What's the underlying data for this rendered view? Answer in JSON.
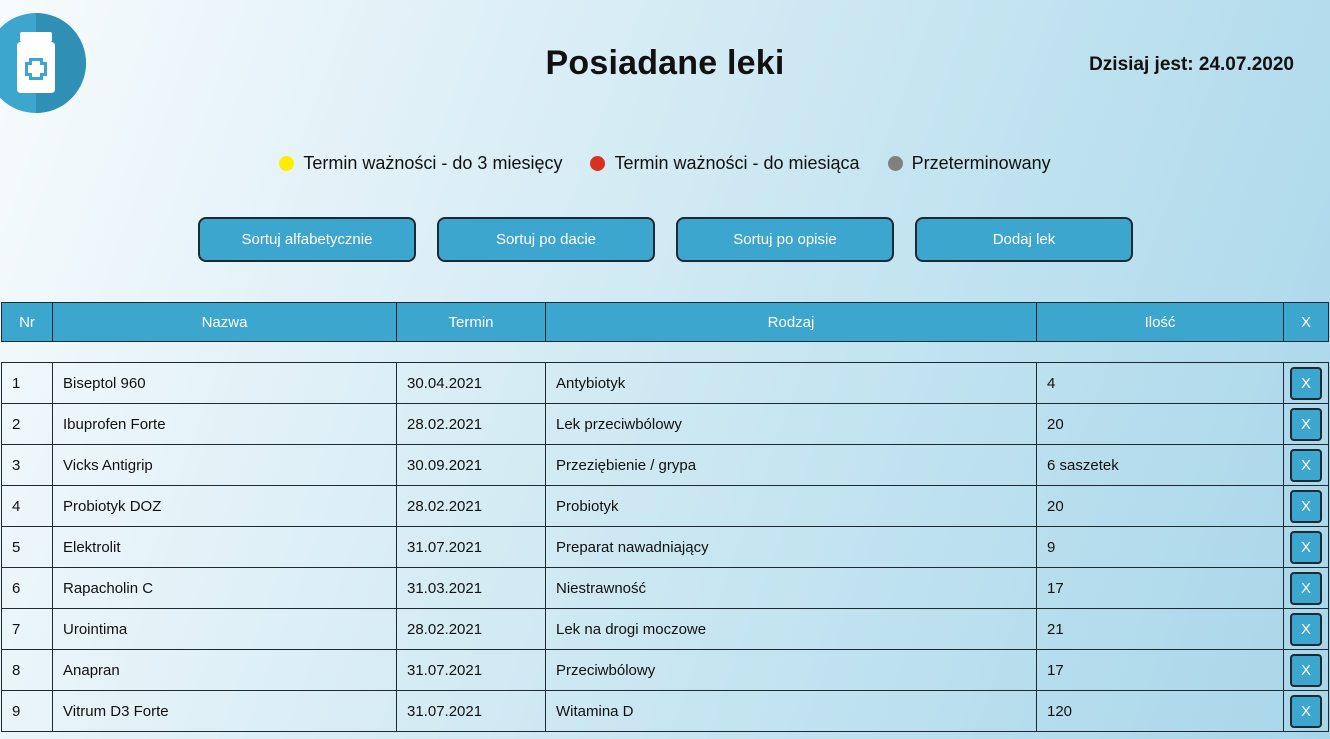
{
  "header": {
    "title": "Posiadane leki",
    "today": "Dzisiaj jest: 24.07.2020",
    "logo_icon": "medicine-bottle-icon"
  },
  "legend": [
    {
      "label": "Termin ważności - do 3 miesięcy",
      "color": "#ffee00"
    },
    {
      "label": "Termin ważności - do miesiąca",
      "color": "#d9301f"
    },
    {
      "label": "Przeterminowany",
      "color": "#808080"
    }
  ],
  "buttons": {
    "sort_alpha": "Sortuj alfabetycznie",
    "sort_date": "Sortuj po dacie",
    "sort_desc": "Sortuj po opisie",
    "add": "Dodaj lek"
  },
  "table": {
    "columns": [
      "Nr",
      "Nazwa",
      "Termin",
      "Rodzaj",
      "Ilość",
      "X"
    ],
    "rows": [
      {
        "nr": "1",
        "name": "Biseptol 960",
        "date": "30.04.2021",
        "type": "Antybiotyk",
        "qty": "4",
        "del": "X"
      },
      {
        "nr": "2",
        "name": "Ibuprofen Forte",
        "date": "28.02.2021",
        "type": "Lek przeciwbólowy",
        "qty": "20",
        "del": "X"
      },
      {
        "nr": "3",
        "name": "Vicks Antigrip",
        "date": "30.09.2021",
        "type": "Przeziębienie / grypa",
        "qty": "6 saszetek",
        "del": "X"
      },
      {
        "nr": "4",
        "name": "Probiotyk DOZ",
        "date": "28.02.2021",
        "type": "Probiotyk",
        "qty": "20",
        "del": "X"
      },
      {
        "nr": "5",
        "name": "Elektrolit",
        "date": "31.07.2021",
        "type": "Preparat nawadniający",
        "qty": "9",
        "del": "X"
      },
      {
        "nr": "6",
        "name": "Rapacholin C",
        "date": "31.03.2021",
        "type": "Niestrawność",
        "qty": "17",
        "del": "X"
      },
      {
        "nr": "7",
        "name": "Urointima",
        "date": "28.02.2021",
        "type": "Lek na drogi moczowe",
        "qty": "21",
        "del": "X"
      },
      {
        "nr": "8",
        "name": "Anapran",
        "date": "31.07.2021",
        "type": "Przeciwbólowy",
        "qty": "17",
        "del": "X"
      },
      {
        "nr": "9",
        "name": "Vitrum D3 Forte",
        "date": "31.07.2021",
        "type": "Witamina D",
        "qty": "120",
        "del": "X"
      }
    ]
  },
  "colors": {
    "accent": "#3da6cf",
    "border": "#1b2a33"
  }
}
